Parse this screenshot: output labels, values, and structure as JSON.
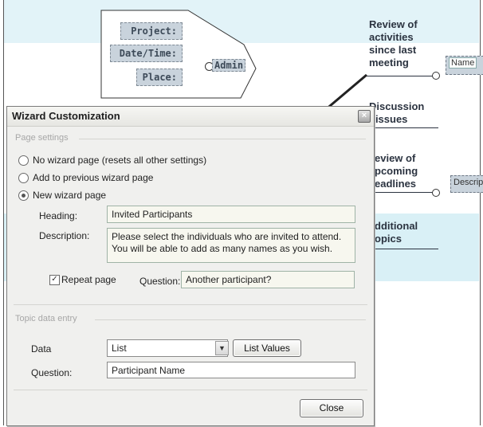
{
  "mindmap": {
    "admin_fields": [
      "Project:",
      "Date/Time:",
      "Place:"
    ],
    "admin_label": "Admin",
    "topics": [
      {
        "lines": [
          "Review of",
          "activities",
          "since last",
          "meeting"
        ]
      },
      {
        "lines": [
          "Discussion",
          "f issues"
        ]
      },
      {
        "lines": [
          "eview of",
          "pcoming",
          "eadlines"
        ]
      },
      {
        "lines": [
          "dditional",
          "opics"
        ]
      }
    ],
    "name_tag": "Name",
    "descrip_tag": "Descrip"
  },
  "dialog": {
    "title": "Wizard Customization",
    "close_icon": "×",
    "page_settings_label": "Page settings",
    "radios": [
      {
        "label": "No wizard page (resets all other settings)",
        "checked": false
      },
      {
        "label": "Add to previous wizard page",
        "checked": false
      },
      {
        "label": "New wizard page",
        "checked": true
      }
    ],
    "heading_label": "Heading:",
    "heading_value": "Invited Participants",
    "description_label": "Description:",
    "description_value": "Please select the individuals who are invited to attend. You will be able to add as many names as you wish.",
    "repeat_page_label": "Repeat page",
    "repeat_page_checked": true,
    "question_label": "Question:",
    "question_value": "Another participant?",
    "topic_data_label": "Topic data entry",
    "data_label": "Data",
    "data_value": "List",
    "list_values_button": "List Values",
    "question2_label": "Question:",
    "question2_value": "Participant Name",
    "close_button": "Close"
  }
}
